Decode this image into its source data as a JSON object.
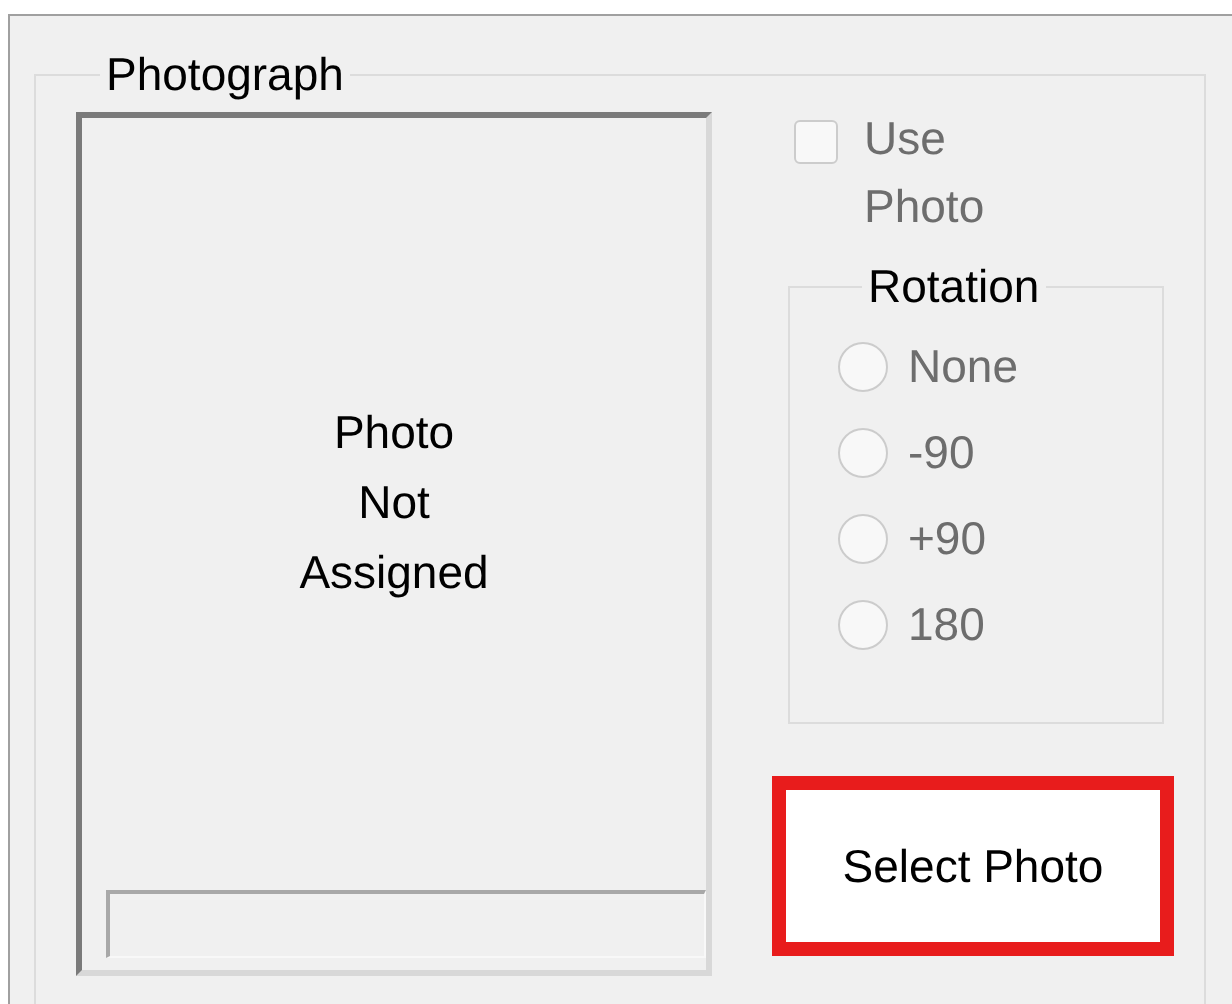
{
  "photograph_group": {
    "title": "Photograph",
    "photo_frame": {
      "placeholder_text": "Photo Not Assigned"
    },
    "use_photo": {
      "label": "Use Photo",
      "checked": false,
      "disabled": true
    },
    "rotation": {
      "title": "Rotation",
      "options": [
        {
          "label": "None",
          "selected": false,
          "disabled": true
        },
        {
          "label": "-90",
          "selected": false,
          "disabled": true
        },
        {
          "label": "+90",
          "selected": false,
          "disabled": true
        },
        {
          "label": "180",
          "selected": false,
          "disabled": true
        }
      ]
    },
    "select_button": {
      "label": "Select Photo",
      "highlighted": true
    }
  }
}
